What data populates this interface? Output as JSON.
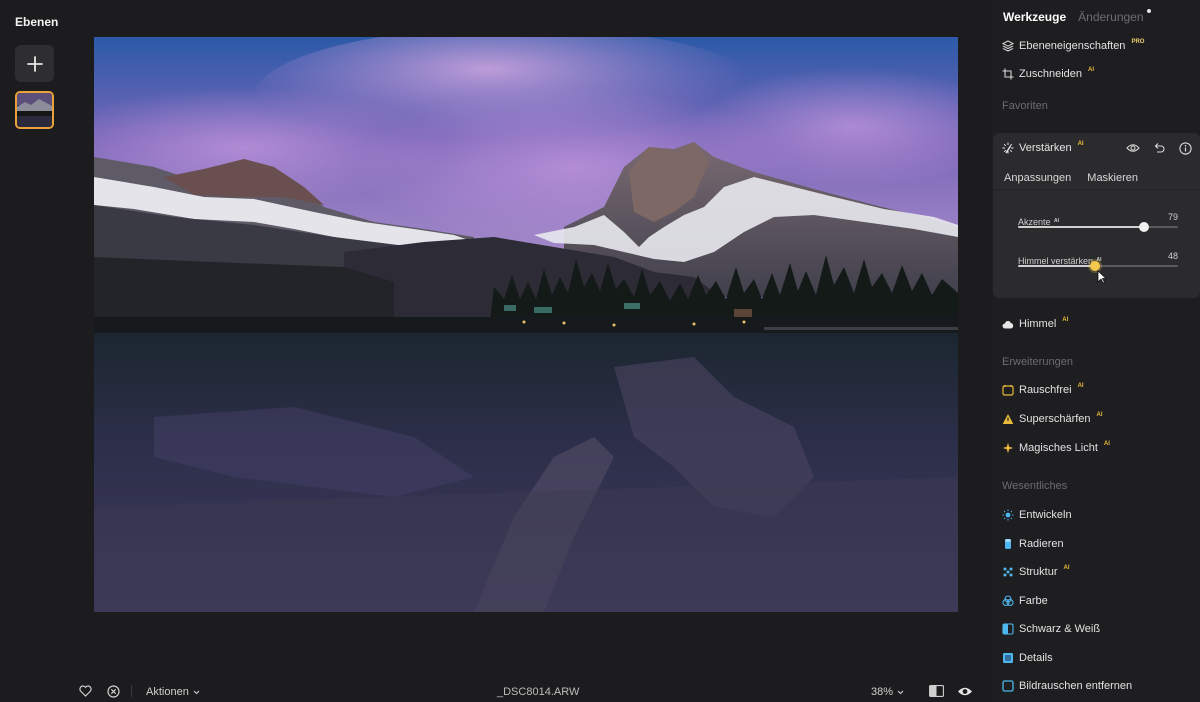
{
  "layers": {
    "title": "Ebenen",
    "add_icon": "plus-icon"
  },
  "canvas": {
    "filename": "_DSC8014.ARW",
    "actions_label": "Aktionen",
    "zoom": "38%"
  },
  "panel": {
    "tabs": {
      "tools": "Werkzeuge",
      "changes": "Änderungen"
    },
    "layer_props": {
      "label": "Ebeneneigenschaften",
      "badge": "PRO"
    },
    "crop": {
      "label": "Zuschneiden",
      "badge": "AI"
    },
    "favorites_label": "Favoriten",
    "enhance": {
      "label": "Verstärken",
      "badge": "AI",
      "subtabs": [
        "Anpassungen",
        "Maskieren"
      ],
      "sliders": [
        {
          "label": "Akzente",
          "badge": "AI",
          "value": 79
        },
        {
          "label": "Himmel verstärken",
          "badge": "AI",
          "value": 48
        }
      ]
    },
    "sky": {
      "label": "Himmel",
      "badge": "AI"
    },
    "extensions_label": "Erweiterungen",
    "extensions": [
      {
        "label": "Rauschfrei",
        "badge": "AI",
        "icon": "noise-free-icon",
        "color": "#e8b93a"
      },
      {
        "label": "Superschärfen",
        "badge": "AI",
        "icon": "sharpen-triangle-icon",
        "color": "#e8b93a"
      },
      {
        "label": "Magisches Licht",
        "badge": "AI",
        "icon": "magic-light-icon",
        "color": "#e8b93a"
      }
    ],
    "essentials_label": "Wesentliches",
    "essentials": [
      {
        "label": "Entwickeln",
        "badge": "",
        "icon": "sun-icon",
        "color": "#4fb7f0"
      },
      {
        "label": "Radieren",
        "badge": "",
        "icon": "eraser-icon",
        "color": "#4fb7f0"
      },
      {
        "label": "Struktur",
        "badge": "AI",
        "icon": "structure-icon",
        "color": "#4fb7f0"
      },
      {
        "label": "Farbe",
        "badge": "",
        "icon": "color-icon",
        "color": "#4fb7f0"
      },
      {
        "label": "Schwarz & Weiß",
        "badge": "",
        "icon": "black-white-icon",
        "color": "#4fb7f0"
      },
      {
        "label": "Details",
        "badge": "",
        "icon": "details-icon",
        "color": "#4fb7f0"
      },
      {
        "label": "Bildrauschen entfernen",
        "badge": "",
        "icon": "denoise-icon",
        "color": "#4fb7f0"
      }
    ]
  },
  "colors": {
    "accent": "#e9a23b",
    "knob_active": "#f3c94d",
    "essentials": "#4fb7f0",
    "panel_bg": "#1e1e20",
    "app_bg": "#1c1c1e"
  }
}
